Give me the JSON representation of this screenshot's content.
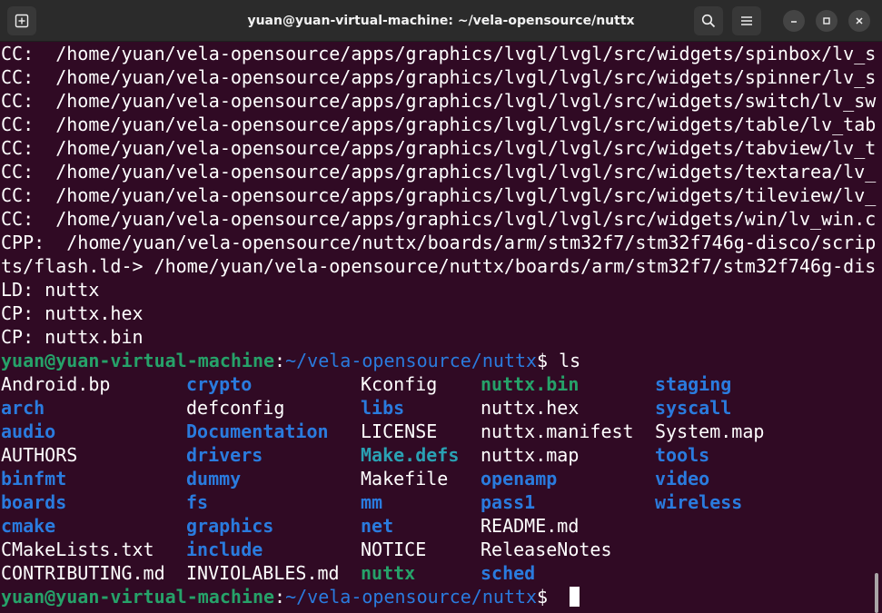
{
  "window": {
    "title": "yuan@yuan-virtual-machine: ~/vela-opensource/nuttx",
    "new_tab_icon": "new-tab-icon",
    "search_icon": "search-icon",
    "menu_icon": "hamburger-menu-icon",
    "minimize_icon": "minimize-icon",
    "maximize_icon": "maximize-icon",
    "close_icon": "close-icon"
  },
  "output": [
    "CC:  /home/yuan/vela-opensource/apps/graphics/lvgl/lvgl/src/widgets/spinbox/lv_s",
    "CC:  /home/yuan/vela-opensource/apps/graphics/lvgl/lvgl/src/widgets/spinner/lv_s",
    "CC:  /home/yuan/vela-opensource/apps/graphics/lvgl/lvgl/src/widgets/switch/lv_sw",
    "CC:  /home/yuan/vela-opensource/apps/graphics/lvgl/lvgl/src/widgets/table/lv_tab",
    "CC:  /home/yuan/vela-opensource/apps/graphics/lvgl/lvgl/src/widgets/tabview/lv_t",
    "CC:  /home/yuan/vela-opensource/apps/graphics/lvgl/lvgl/src/widgets/textarea/lv_",
    "CC:  /home/yuan/vela-opensource/apps/graphics/lvgl/lvgl/src/widgets/tileview/lv_",
    "CC:  /home/yuan/vela-opensource/apps/graphics/lvgl/lvgl/src/widgets/win/lv_win.c",
    "CPP:  /home/yuan/vela-opensource/nuttx/boards/arm/stm32f7/stm32f746g-disco/scrip",
    "ts/flash.ld-> /home/yuan/vela-opensource/nuttx/boards/arm/stm32f7/stm32f746g-dis",
    "LD: nuttx",
    "CP: nuttx.hex",
    "CP: nuttx.bin"
  ],
  "prompt": {
    "user_host": "yuan@yuan-virtual-machine",
    "sep": ":",
    "path": "~/vela-opensource/nuttx",
    "dollar": "$ ",
    "command": "ls"
  },
  "ls_columns": [
    [
      {
        "name": "Android.bp",
        "kind": "file"
      },
      {
        "name": "arch",
        "kind": "dir"
      },
      {
        "name": "audio",
        "kind": "dir"
      },
      {
        "name": "AUTHORS",
        "kind": "file"
      },
      {
        "name": "binfmt",
        "kind": "dir"
      },
      {
        "name": "boards",
        "kind": "dir"
      },
      {
        "name": "cmake",
        "kind": "dir"
      },
      {
        "name": "CMakeLists.txt",
        "kind": "file"
      },
      {
        "name": "CONTRIBUTING.md",
        "kind": "file"
      }
    ],
    [
      {
        "name": "crypto",
        "kind": "dir"
      },
      {
        "name": "defconfig",
        "kind": "file"
      },
      {
        "name": "Documentation",
        "kind": "dir"
      },
      {
        "name": "drivers",
        "kind": "dir"
      },
      {
        "name": "dummy",
        "kind": "dir"
      },
      {
        "name": "fs",
        "kind": "dir"
      },
      {
        "name": "graphics",
        "kind": "dir"
      },
      {
        "name": "include",
        "kind": "dir"
      },
      {
        "name": "INVIOLABLES.md",
        "kind": "file"
      }
    ],
    [
      {
        "name": "Kconfig",
        "kind": "file"
      },
      {
        "name": "libs",
        "kind": "dir"
      },
      {
        "name": "LICENSE",
        "kind": "file"
      },
      {
        "name": "Make.defs",
        "kind": "link"
      },
      {
        "name": "Makefile",
        "kind": "file"
      },
      {
        "name": "mm",
        "kind": "dir"
      },
      {
        "name": "net",
        "kind": "dir"
      },
      {
        "name": "NOTICE",
        "kind": "file"
      },
      {
        "name": "nuttx",
        "kind": "exec"
      }
    ],
    [
      {
        "name": "nuttx.bin",
        "kind": "exec"
      },
      {
        "name": "nuttx.hex",
        "kind": "file"
      },
      {
        "name": "nuttx.manifest",
        "kind": "file"
      },
      {
        "name": "nuttx.map",
        "kind": "file"
      },
      {
        "name": "openamp",
        "kind": "dir"
      },
      {
        "name": "pass1",
        "kind": "dir"
      },
      {
        "name": "README.md",
        "kind": "file"
      },
      {
        "name": "ReleaseNotes",
        "kind": "file"
      },
      {
        "name": "sched",
        "kind": "dir"
      }
    ],
    [
      {
        "name": "staging",
        "kind": "dir"
      },
      {
        "name": "syscall",
        "kind": "dir"
      },
      {
        "name": "System.map",
        "kind": "file"
      },
      {
        "name": "tools",
        "kind": "dir"
      },
      {
        "name": "video",
        "kind": "dir"
      },
      {
        "name": "wireless",
        "kind": "dir"
      }
    ]
  ],
  "colors": {
    "background": "#300a24",
    "user_host": "#26a269",
    "path": "#2a7bde",
    "directory": "#2a7bde",
    "executable": "#26a269",
    "symlink": "#2aa1b3",
    "text": "#ffffff"
  }
}
